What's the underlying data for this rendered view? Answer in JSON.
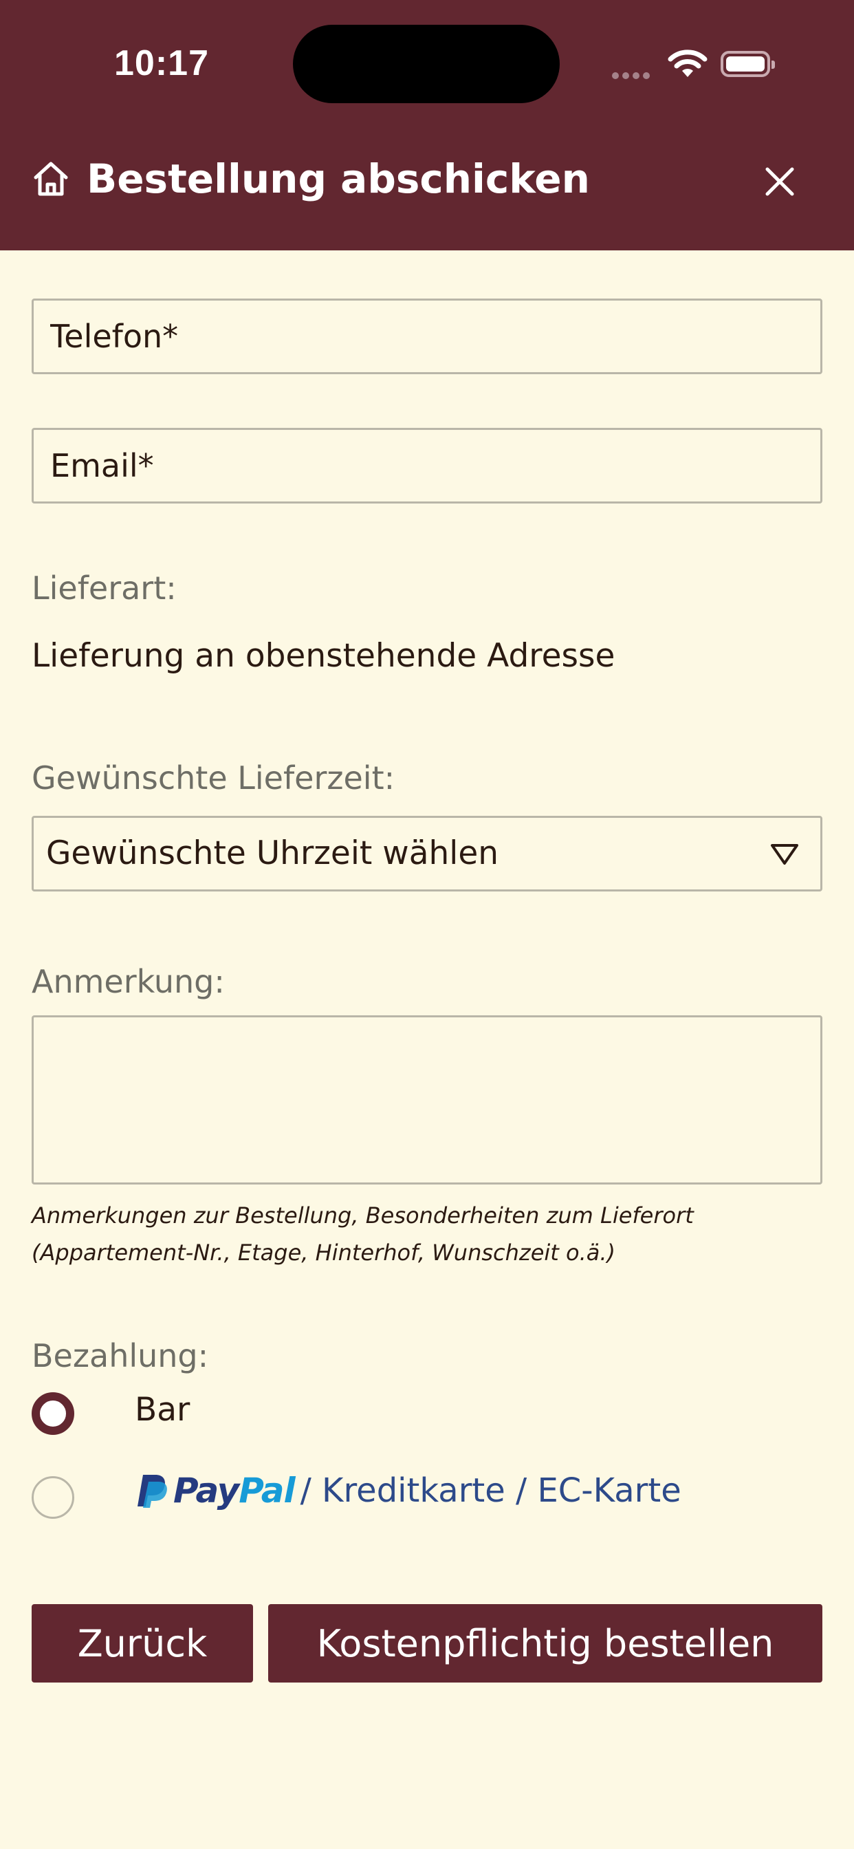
{
  "status_bar": {
    "time": "10:17"
  },
  "header": {
    "title": "Bestellung abschicken",
    "icon_left": "home-icon",
    "icon_right": "close-icon",
    "background_color": "#622730"
  },
  "form": {
    "phone_placeholder": "Telefon*",
    "email_placeholder": "Email*",
    "delivery_type_label": "Lieferart:",
    "delivery_type_value": "Lieferung an obenstehende Adresse",
    "delivery_time_label": "Gewünschte Lieferzeit:",
    "delivery_time_selected": "Gewünschte Uhrzeit wählen",
    "note_label": "Anmerkung:",
    "note_value": "",
    "note_hint_line1": "Anmerkungen zur Bestellung, Besonderheiten zum Lieferort",
    "note_hint_line2": "(Appartement-Nr., Etage, Hinterhof, Wunschzeit o.ä.)"
  },
  "payment": {
    "label": "Bezahlung:",
    "options": [
      {
        "label": "Bar",
        "selected": true
      },
      {
        "logo_pay": "Pay",
        "logo_pal": "Pal",
        "label": "/ Kreditkarte / EC-Karte",
        "selected": false
      }
    ]
  },
  "buttons": {
    "back": "Zurück",
    "order": "Kostenpflichtig bestellen"
  },
  "colors": {
    "brand": "#622730",
    "background": "#fdf9e4",
    "paypal_dark": "#253b80",
    "paypal_light": "#179bd7"
  }
}
